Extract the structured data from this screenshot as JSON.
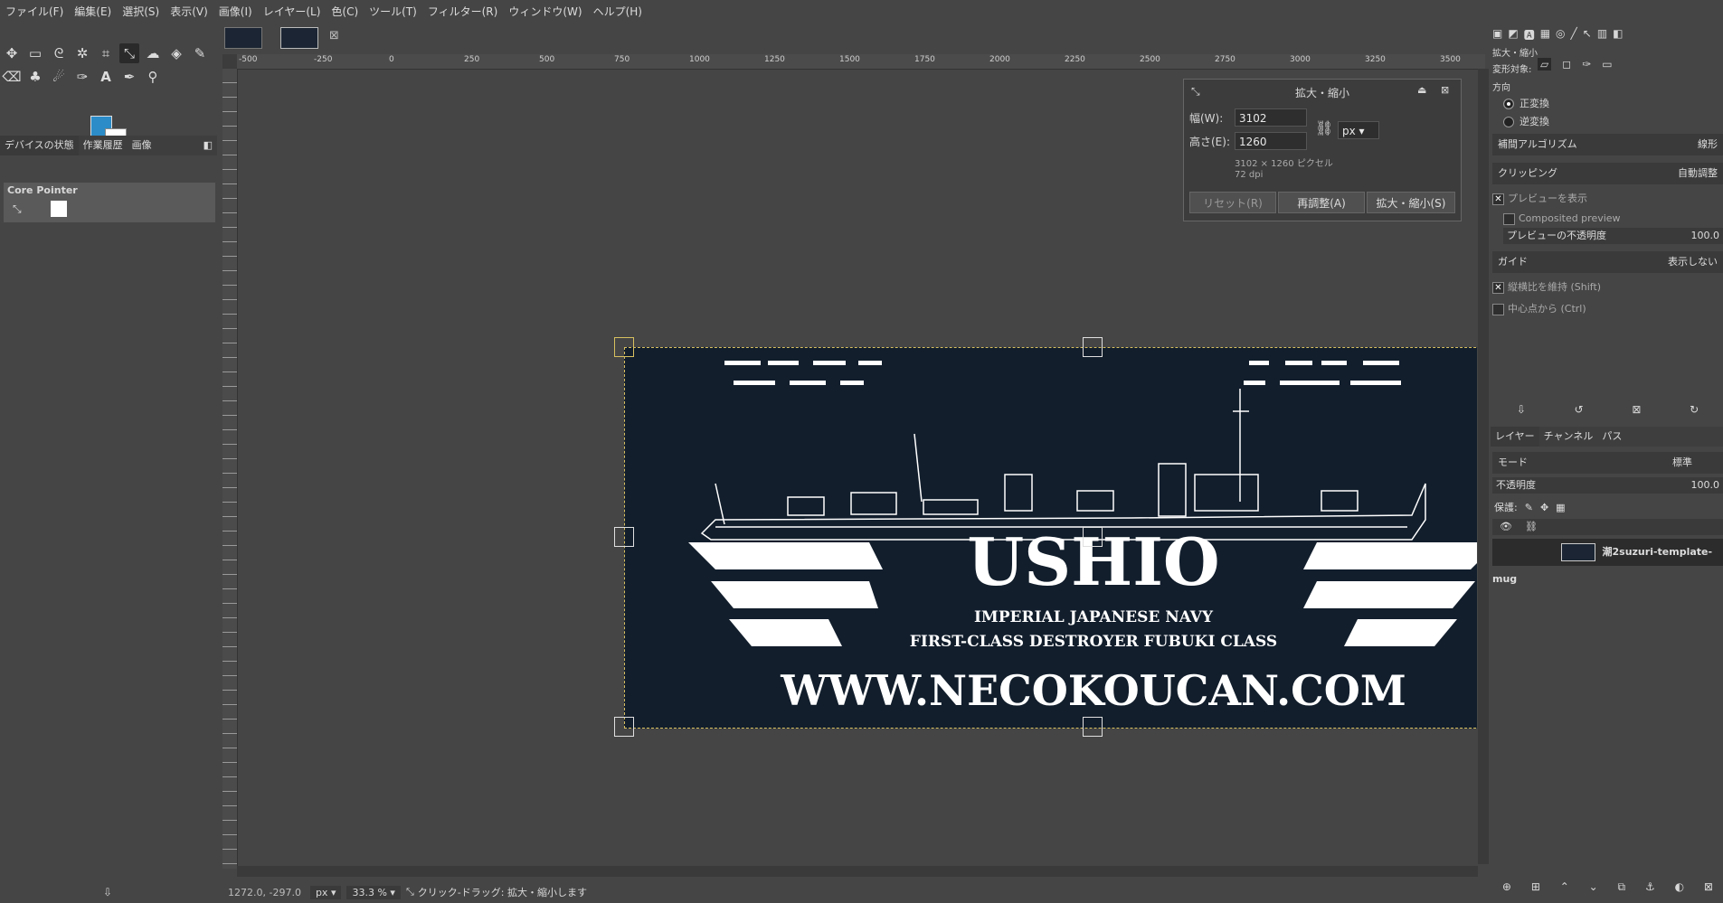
{
  "menu": [
    "ファイル(F)",
    "編集(E)",
    "選択(S)",
    "表示(V)",
    "画像(I)",
    "レイヤー(L)",
    "色(C)",
    "ツール(T)",
    "フィルター(R)",
    "ウィンドウ(W)",
    "ヘルプ(H)"
  ],
  "toolbox": {
    "tabs": [
      "デバイスの状態",
      "作業履歴",
      "画像"
    ],
    "core_pointer": "Core Pointer",
    "fg_color": "#2b8cc8",
    "bg_color": "#ffffff"
  },
  "ruler_labels": [
    "-500",
    "-250",
    "0",
    "250",
    "500",
    "750",
    "1000",
    "1250",
    "1500",
    "1750",
    "2000",
    "2250",
    "2500",
    "2750",
    "3000",
    "3250",
    "3500"
  ],
  "canvas": {
    "image_bg": "#121e2c",
    "logo_title": "USHIO",
    "logo_line1": "IMPERIAL JAPANESE NAVY",
    "logo_line2": "FIRST-CLASS DESTROYER FUBUKI CLASS",
    "logo_url": "WWW.NECOKOUCAN.COM"
  },
  "scale_dialog": {
    "title": "拡大・縮小",
    "width_label": "幅(W):",
    "width_value": "3102",
    "height_label": "高さ(E):",
    "height_value": "1260",
    "unit": "px",
    "size_info": "3102 × 1260 ピクセル",
    "dpi_info": "72 dpi",
    "reset_label": "リセット(R)",
    "readjust_label": "再調整(A)",
    "scale_label": "拡大・縮小(S)"
  },
  "status": {
    "coords": "1272.0, -297.0",
    "unit": "px",
    "zoom": "33.3 %",
    "message": "クリック-ドラッグ: 拡大・縮小します"
  },
  "tool_options": {
    "title": "拡大・縮小",
    "transform_label": "変形対象:",
    "direction_label": "方向",
    "direction_normal": "正変換",
    "direction_reverse": "逆変換",
    "interp_label": "補間アルゴリズム",
    "interp_value": "線形",
    "clipping_label": "クリッピング",
    "clipping_value": "自動調整",
    "show_preview": "プレビューを表示",
    "composited_preview": "Composited preview",
    "preview_opacity_label": "プレビューの不透明度",
    "preview_opacity_value": "100.0",
    "guide_label": "ガイド",
    "guide_value": "表示しない",
    "keep_aspect": "縦横比を維持 (Shift)",
    "from_center": "中心点から (Ctrl)"
  },
  "layers": {
    "tabs": [
      "レイヤー",
      "チャンネル",
      "パス"
    ],
    "mode_label": "モード",
    "mode_value": "標準",
    "opacity_label": "不透明度",
    "opacity_value": "100.0",
    "lock_label": "保護:",
    "layer_name": "潮2suzuri-template-mug"
  }
}
